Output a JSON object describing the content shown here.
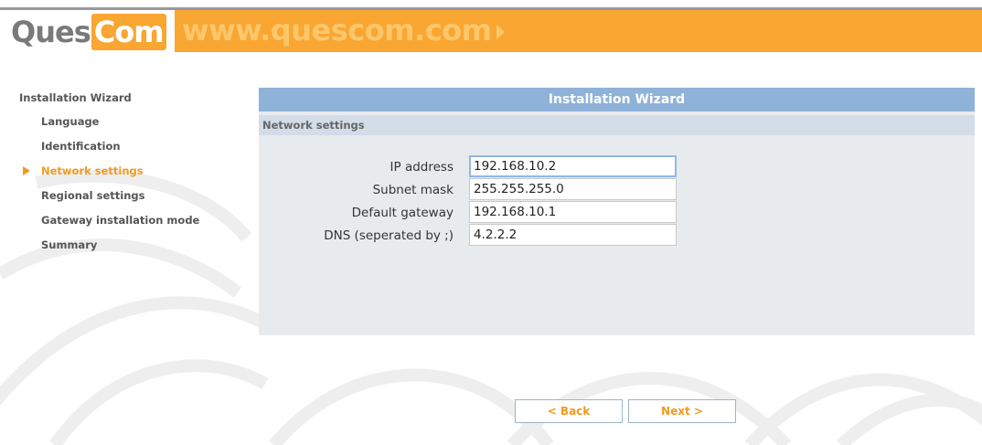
{
  "header": {
    "logo_part1": "Ques",
    "logo_part2": "Com",
    "site_url": "www.quescom.com",
    "brand_color": "#f9a632"
  },
  "sidebar": {
    "title": "Installation Wizard",
    "items": [
      {
        "label": "Language",
        "active": false
      },
      {
        "label": "Identification",
        "active": false
      },
      {
        "label": "Network settings",
        "active": true
      },
      {
        "label": "Regional settings",
        "active": false
      },
      {
        "label": "Gateway installation mode",
        "active": false
      },
      {
        "label": "Summary",
        "active": false
      }
    ],
    "active_marker_icon": "triangle-right-icon"
  },
  "panel": {
    "title": "Installation Wizard",
    "section": "Network settings",
    "fields": [
      {
        "label": "IP address",
        "value": "192.168.10.2",
        "focused": true
      },
      {
        "label": "Subnet mask",
        "value": "255.255.255.0",
        "focused": false
      },
      {
        "label": "Default gateway",
        "value": "192.168.10.1",
        "focused": false
      },
      {
        "label": "DNS (seperated by ;)",
        "value": "4.2.2.2",
        "focused": false
      }
    ]
  },
  "buttons": {
    "back": "< Back",
    "next": "Next >"
  },
  "colors": {
    "accent": "#f29a1f",
    "title_bar": "#8fb2d8",
    "section_bar": "#d3dde8",
    "panel_bg": "#e8ebee"
  }
}
